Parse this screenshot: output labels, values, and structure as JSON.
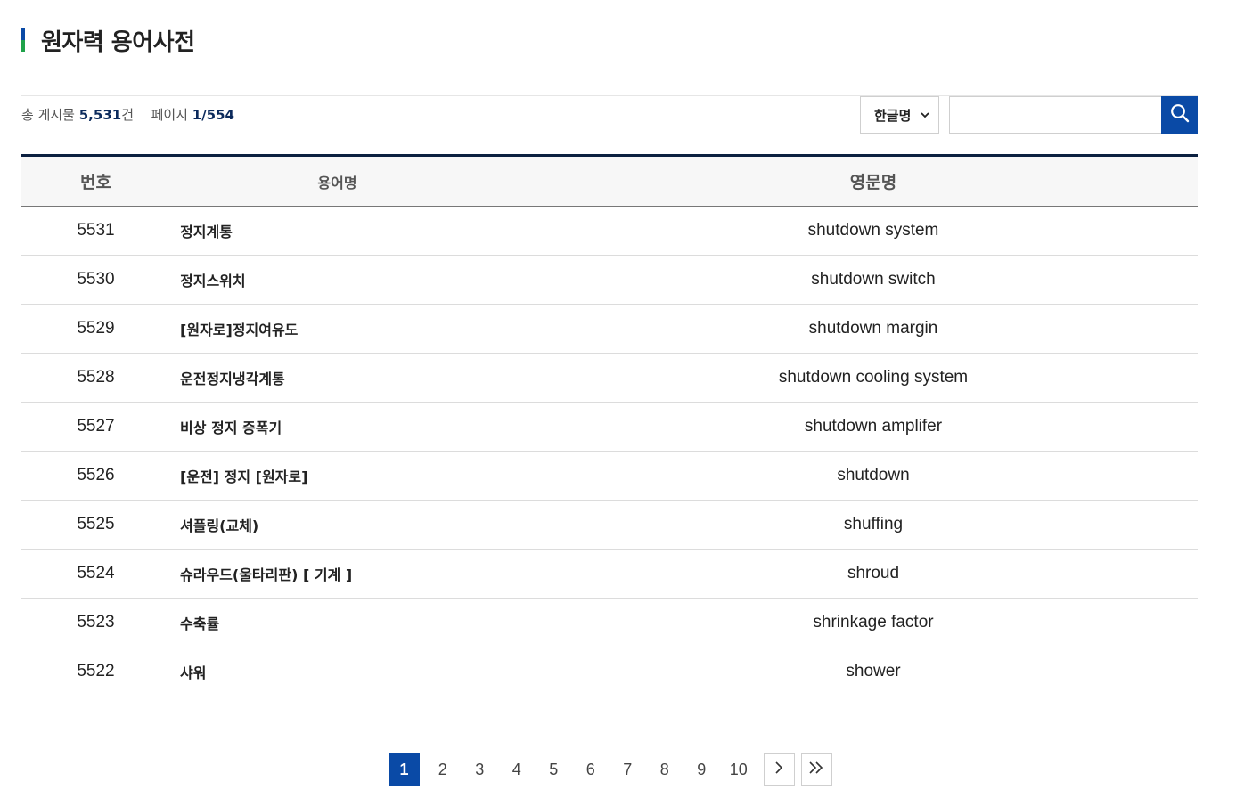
{
  "page": {
    "title": "원자력 용어사전"
  },
  "summary": {
    "total_label": "총 게시물",
    "total_count": "5,531",
    "total_unit": "건",
    "page_label": "페이지",
    "page_value": "1/554"
  },
  "search": {
    "select_value": "한글명",
    "input_value": "",
    "placeholder": ""
  },
  "table": {
    "headers": [
      "번호",
      "용어명",
      "영문명"
    ],
    "rows": [
      {
        "no": "5531",
        "term": "정지계통",
        "eng": "shutdown system"
      },
      {
        "no": "5530",
        "term": "정지스위치",
        "eng": "shutdown switch"
      },
      {
        "no": "5529",
        "term": "[원자로]정지여유도",
        "eng": "shutdown margin"
      },
      {
        "no": "5528",
        "term": "운전정지냉각계통",
        "eng": "shutdown cooling system"
      },
      {
        "no": "5527",
        "term": "비상 정지 증폭기",
        "eng": "shutdown amplifer"
      },
      {
        "no": "5526",
        "term": "[운전] 정지 [원자로]",
        "eng": "shutdown"
      },
      {
        "no": "5525",
        "term": "셔플링(교체)",
        "eng": "shuffing"
      },
      {
        "no": "5524",
        "term": "슈라우드(울타리판) [ 기계 ]",
        "eng": "shroud"
      },
      {
        "no": "5523",
        "term": "수축률",
        "eng": "shrinkage factor"
      },
      {
        "no": "5522",
        "term": "샤워",
        "eng": "shower"
      }
    ]
  },
  "pagination": {
    "active": "1",
    "pages": [
      "2",
      "3",
      "4",
      "5",
      "6",
      "7",
      "8",
      "9",
      "10"
    ]
  },
  "colors": {
    "accent": "#0a4aa6",
    "title_bar_green": "#1fa24a",
    "table_top_border": "#0b2040"
  },
  "icons": {
    "search": "search-icon",
    "select": "chevron-down-icon",
    "next": "chevron-right-icon",
    "last": "double-chevron-right-icon"
  }
}
